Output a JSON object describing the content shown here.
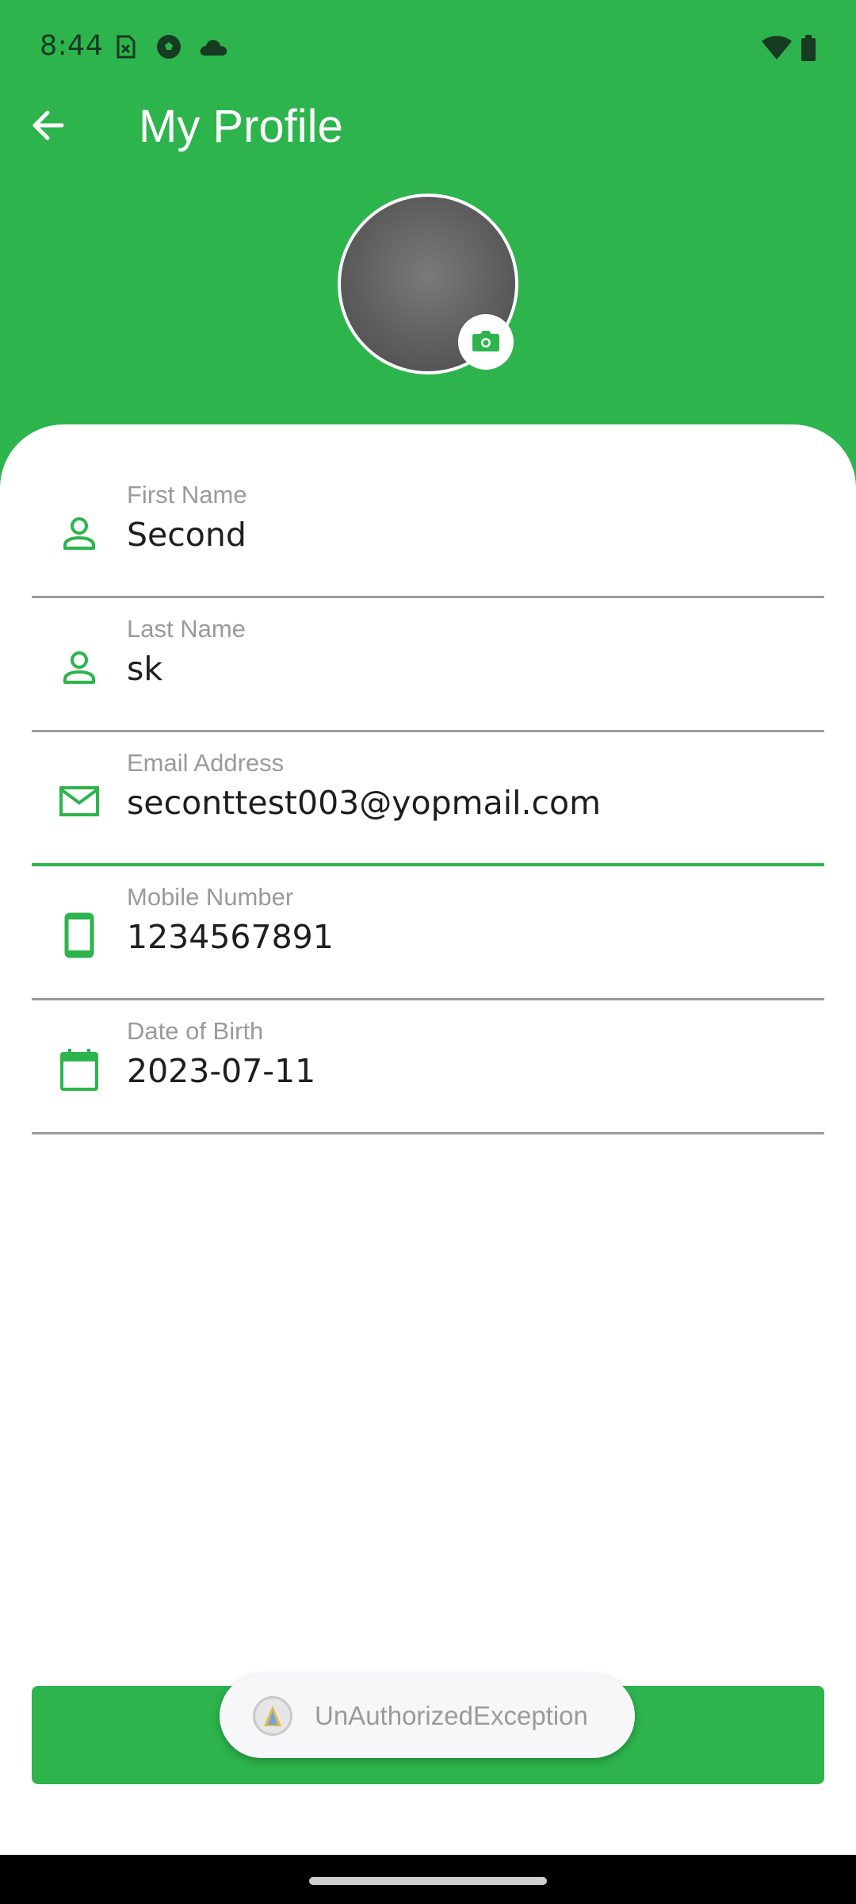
{
  "status": {
    "time": "8:44",
    "left_icons": [
      "sim-off-icon",
      "soccer-ball-icon",
      "cloud-icon"
    ],
    "right_icons": [
      "wifi-icon",
      "battery-icon"
    ]
  },
  "toolbar": {
    "title": "My Profile",
    "back_icon": "arrow-left-icon"
  },
  "avatar": {
    "camera_icon": "camera-icon"
  },
  "fields": [
    {
      "label": "First Name",
      "value": "Second",
      "icon": "person-icon"
    },
    {
      "label": "Last Name",
      "value": "sk",
      "icon": "person-icon"
    },
    {
      "label": "Email Address",
      "value": "seconttest003@yopmail.com",
      "icon": "mail-icon"
    },
    {
      "label": "Mobile Number",
      "value": "1234567891",
      "icon": "phone-icon"
    },
    {
      "label": "Date of Birth",
      "value": "2023-07-11",
      "icon": "calendar-icon"
    }
  ],
  "toast": {
    "message": "UnAuthorizedException"
  },
  "colors": {
    "primary": "#2db44c",
    "underline": "#9a9a9a"
  }
}
